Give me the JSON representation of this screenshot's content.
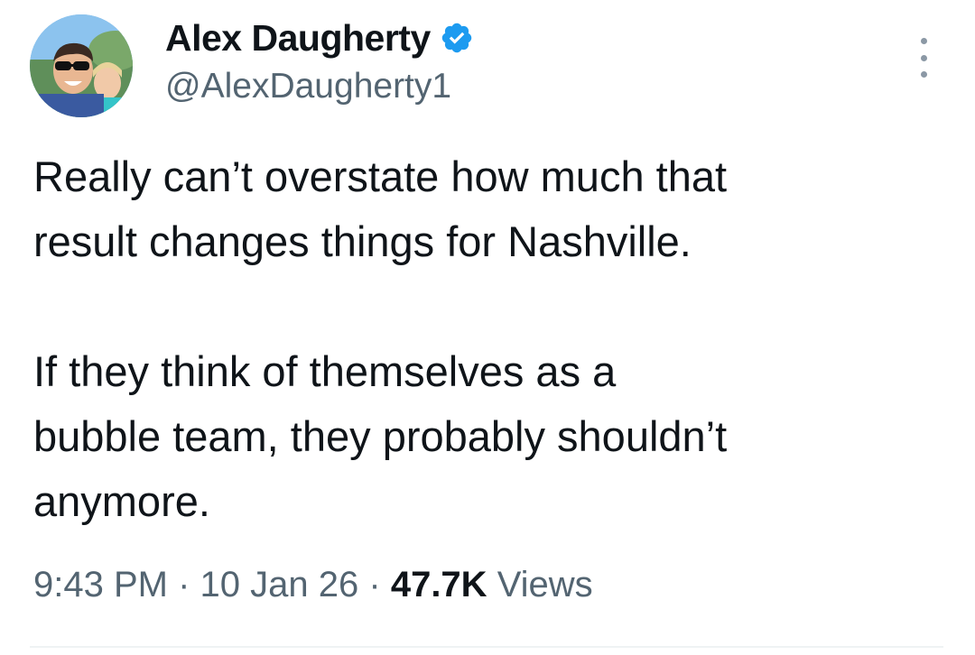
{
  "author": {
    "display_name": "Alex Daugherty",
    "handle": "@AlexDaugherty1",
    "verified": true,
    "verified_color": "#1d9bf0",
    "avatar_icon": "profile-photo"
  },
  "tweet": {
    "line1": "Really can’t overstate how much that",
    "line2": "result changes things for Nashville.",
    "line3": "If they think of themselves as a",
    "line4": "bubble team, they probably shouldn’t",
    "line5": "anymore."
  },
  "meta": {
    "time": "9:43 PM",
    "separator": "·",
    "date": "10 Jan 26",
    "views_count": "47.7K",
    "views_label": "Views"
  },
  "menu": {
    "icon": "more-icon"
  }
}
